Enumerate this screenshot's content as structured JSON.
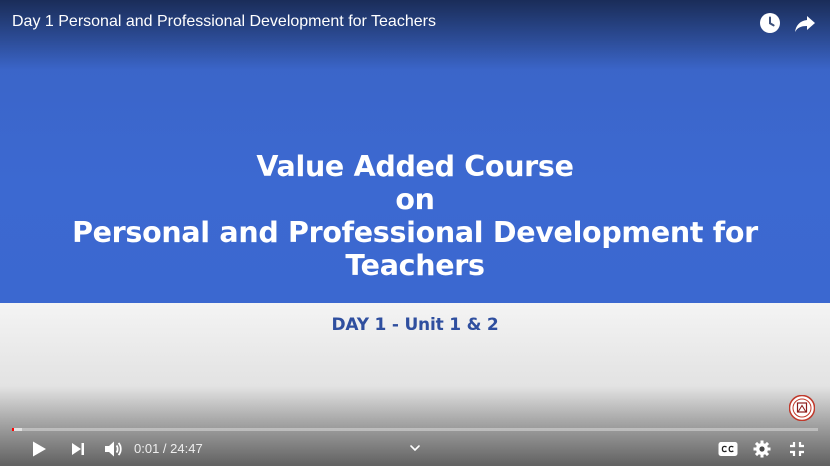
{
  "video": {
    "title": "Day 1 Personal and Professional Development for Teachers"
  },
  "slide": {
    "title_lines": [
      "Value Added Course",
      "on",
      "Personal and Professional Development for",
      "Teachers"
    ],
    "subtitle": "DAY 1 - Unit 1 & 2"
  },
  "player": {
    "current_time": "0:01",
    "separator": " / ",
    "duration": "24:47",
    "progress_played_fraction": 0.001,
    "progress_buffered_fraction": 0.012,
    "top_icons": [
      "watch-later-icon",
      "share-icon"
    ],
    "controls": [
      "play-icon",
      "next-icon",
      "volume-icon",
      "chevron-down-icon",
      "captions-icon",
      "settings-icon",
      "exit-fullscreen-icon"
    ]
  },
  "colors": {
    "slide_blue": "#3b68d0",
    "subtitle_blue": "#2f4f9f",
    "progress_red": "#ff0000"
  }
}
